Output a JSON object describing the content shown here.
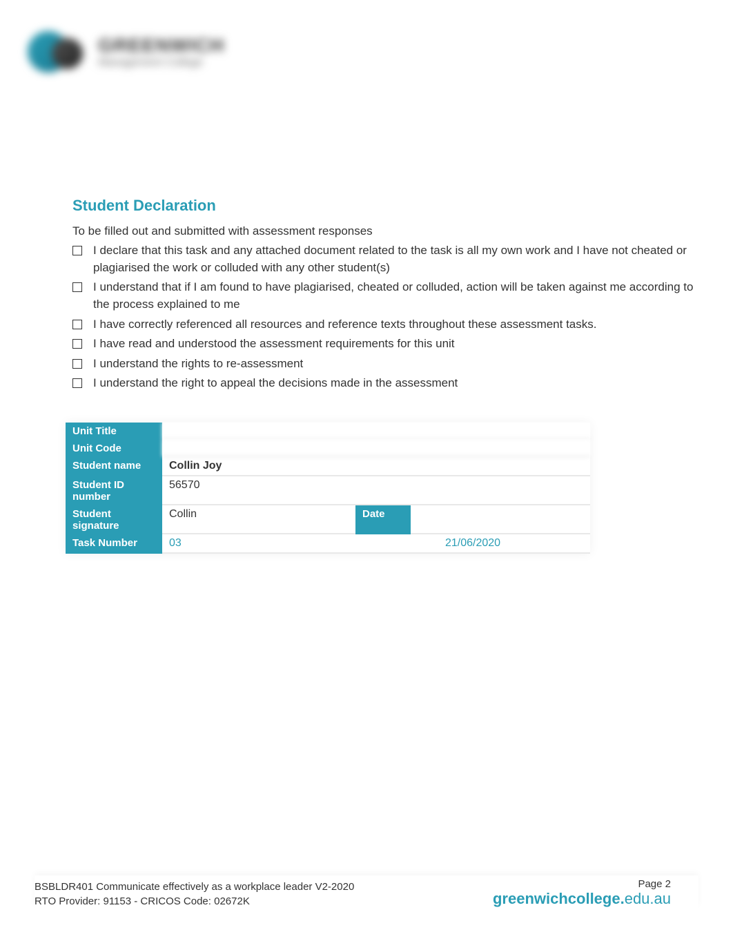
{
  "logo": {
    "text_top": "GREENWICH",
    "text_bottom": "Management College"
  },
  "section_title": "Student Declaration",
  "intro": "To be filled out and submitted with assessment responses",
  "checklist": [
    "I declare that this task and any attached document related to the task is all my own work and I have not cheated or plagiarised the work or colluded with any other student(s)",
    "I understand that if I am found to have plagiarised, cheated or colluded, action will be taken against me according to the process explained to me",
    "I have correctly referenced all resources and reference texts throughout these assessment tasks.",
    "I have read and understood the assessment requirements for this unit",
    "I understand the rights to re-assessment",
    "I understand the right to appeal the decisions made in the assessment"
  ],
  "table": {
    "labels": {
      "unit_title": "Unit Title",
      "unit_code": "Unit Code",
      "student_name": "Student name",
      "student_id": "Student ID number",
      "student_signature": "Student signature",
      "date": "Date",
      "task_number": "Task Number"
    },
    "values": {
      "unit_title": "",
      "unit_code": "",
      "student_name": "Collin Joy",
      "student_id": "56570",
      "student_signature": "Collin",
      "task_number": "03",
      "date": "21/06/2020"
    }
  },
  "footer": {
    "line1": "BSBLDR401 Communicate effectively as a workplace leader V2-2020",
    "line2": "RTO Provider: 91153  - CRICOS  Code: 02672K",
    "page": "Page 2",
    "url_bold": "greenwichcollege.",
    "url_rest": "edu.au"
  }
}
